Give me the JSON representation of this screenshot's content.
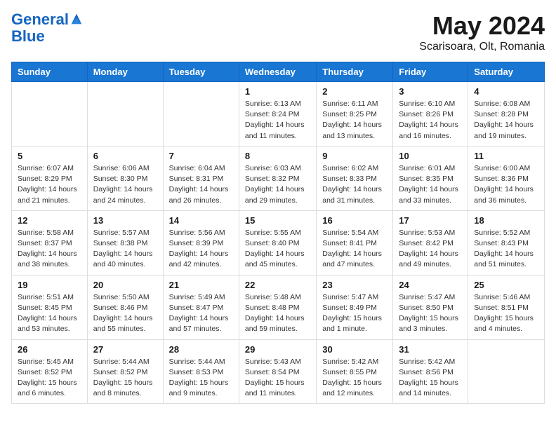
{
  "header": {
    "logo_line1": "General",
    "logo_line2": "Blue",
    "month_title": "May 2024",
    "location": "Scarisoara, Olt, Romania"
  },
  "weekdays": [
    "Sunday",
    "Monday",
    "Tuesday",
    "Wednesday",
    "Thursday",
    "Friday",
    "Saturday"
  ],
  "weeks": [
    [
      {
        "day": "",
        "sunrise": "",
        "sunset": "",
        "daylight": ""
      },
      {
        "day": "",
        "sunrise": "",
        "sunset": "",
        "daylight": ""
      },
      {
        "day": "",
        "sunrise": "",
        "sunset": "",
        "daylight": ""
      },
      {
        "day": "1",
        "sunrise": "Sunrise: 6:13 AM",
        "sunset": "Sunset: 8:24 PM",
        "daylight": "Daylight: 14 hours and 11 minutes."
      },
      {
        "day": "2",
        "sunrise": "Sunrise: 6:11 AM",
        "sunset": "Sunset: 8:25 PM",
        "daylight": "Daylight: 14 hours and 13 minutes."
      },
      {
        "day": "3",
        "sunrise": "Sunrise: 6:10 AM",
        "sunset": "Sunset: 8:26 PM",
        "daylight": "Daylight: 14 hours and 16 minutes."
      },
      {
        "day": "4",
        "sunrise": "Sunrise: 6:08 AM",
        "sunset": "Sunset: 8:28 PM",
        "daylight": "Daylight: 14 hours and 19 minutes."
      }
    ],
    [
      {
        "day": "5",
        "sunrise": "Sunrise: 6:07 AM",
        "sunset": "Sunset: 8:29 PM",
        "daylight": "Daylight: 14 hours and 21 minutes."
      },
      {
        "day": "6",
        "sunrise": "Sunrise: 6:06 AM",
        "sunset": "Sunset: 8:30 PM",
        "daylight": "Daylight: 14 hours and 24 minutes."
      },
      {
        "day": "7",
        "sunrise": "Sunrise: 6:04 AM",
        "sunset": "Sunset: 8:31 PM",
        "daylight": "Daylight: 14 hours and 26 minutes."
      },
      {
        "day": "8",
        "sunrise": "Sunrise: 6:03 AM",
        "sunset": "Sunset: 8:32 PM",
        "daylight": "Daylight: 14 hours and 29 minutes."
      },
      {
        "day": "9",
        "sunrise": "Sunrise: 6:02 AM",
        "sunset": "Sunset: 8:33 PM",
        "daylight": "Daylight: 14 hours and 31 minutes."
      },
      {
        "day": "10",
        "sunrise": "Sunrise: 6:01 AM",
        "sunset": "Sunset: 8:35 PM",
        "daylight": "Daylight: 14 hours and 33 minutes."
      },
      {
        "day": "11",
        "sunrise": "Sunrise: 6:00 AM",
        "sunset": "Sunset: 8:36 PM",
        "daylight": "Daylight: 14 hours and 36 minutes."
      }
    ],
    [
      {
        "day": "12",
        "sunrise": "Sunrise: 5:58 AM",
        "sunset": "Sunset: 8:37 PM",
        "daylight": "Daylight: 14 hours and 38 minutes."
      },
      {
        "day": "13",
        "sunrise": "Sunrise: 5:57 AM",
        "sunset": "Sunset: 8:38 PM",
        "daylight": "Daylight: 14 hours and 40 minutes."
      },
      {
        "day": "14",
        "sunrise": "Sunrise: 5:56 AM",
        "sunset": "Sunset: 8:39 PM",
        "daylight": "Daylight: 14 hours and 42 minutes."
      },
      {
        "day": "15",
        "sunrise": "Sunrise: 5:55 AM",
        "sunset": "Sunset: 8:40 PM",
        "daylight": "Daylight: 14 hours and 45 minutes."
      },
      {
        "day": "16",
        "sunrise": "Sunrise: 5:54 AM",
        "sunset": "Sunset: 8:41 PM",
        "daylight": "Daylight: 14 hours and 47 minutes."
      },
      {
        "day": "17",
        "sunrise": "Sunrise: 5:53 AM",
        "sunset": "Sunset: 8:42 PM",
        "daylight": "Daylight: 14 hours and 49 minutes."
      },
      {
        "day": "18",
        "sunrise": "Sunrise: 5:52 AM",
        "sunset": "Sunset: 8:43 PM",
        "daylight": "Daylight: 14 hours and 51 minutes."
      }
    ],
    [
      {
        "day": "19",
        "sunrise": "Sunrise: 5:51 AM",
        "sunset": "Sunset: 8:45 PM",
        "daylight": "Daylight: 14 hours and 53 minutes."
      },
      {
        "day": "20",
        "sunrise": "Sunrise: 5:50 AM",
        "sunset": "Sunset: 8:46 PM",
        "daylight": "Daylight: 14 hours and 55 minutes."
      },
      {
        "day": "21",
        "sunrise": "Sunrise: 5:49 AM",
        "sunset": "Sunset: 8:47 PM",
        "daylight": "Daylight: 14 hours and 57 minutes."
      },
      {
        "day": "22",
        "sunrise": "Sunrise: 5:48 AM",
        "sunset": "Sunset: 8:48 PM",
        "daylight": "Daylight: 14 hours and 59 minutes."
      },
      {
        "day": "23",
        "sunrise": "Sunrise: 5:47 AM",
        "sunset": "Sunset: 8:49 PM",
        "daylight": "Daylight: 15 hours and 1 minute."
      },
      {
        "day": "24",
        "sunrise": "Sunrise: 5:47 AM",
        "sunset": "Sunset: 8:50 PM",
        "daylight": "Daylight: 15 hours and 3 minutes."
      },
      {
        "day": "25",
        "sunrise": "Sunrise: 5:46 AM",
        "sunset": "Sunset: 8:51 PM",
        "daylight": "Daylight: 15 hours and 4 minutes."
      }
    ],
    [
      {
        "day": "26",
        "sunrise": "Sunrise: 5:45 AM",
        "sunset": "Sunset: 8:52 PM",
        "daylight": "Daylight: 15 hours and 6 minutes."
      },
      {
        "day": "27",
        "sunrise": "Sunrise: 5:44 AM",
        "sunset": "Sunset: 8:52 PM",
        "daylight": "Daylight: 15 hours and 8 minutes."
      },
      {
        "day": "28",
        "sunrise": "Sunrise: 5:44 AM",
        "sunset": "Sunset: 8:53 PM",
        "daylight": "Daylight: 15 hours and 9 minutes."
      },
      {
        "day": "29",
        "sunrise": "Sunrise: 5:43 AM",
        "sunset": "Sunset: 8:54 PM",
        "daylight": "Daylight: 15 hours and 11 minutes."
      },
      {
        "day": "30",
        "sunrise": "Sunrise: 5:42 AM",
        "sunset": "Sunset: 8:55 PM",
        "daylight": "Daylight: 15 hours and 12 minutes."
      },
      {
        "day": "31",
        "sunrise": "Sunrise: 5:42 AM",
        "sunset": "Sunset: 8:56 PM",
        "daylight": "Daylight: 15 hours and 14 minutes."
      },
      {
        "day": "",
        "sunrise": "",
        "sunset": "",
        "daylight": ""
      }
    ]
  ]
}
